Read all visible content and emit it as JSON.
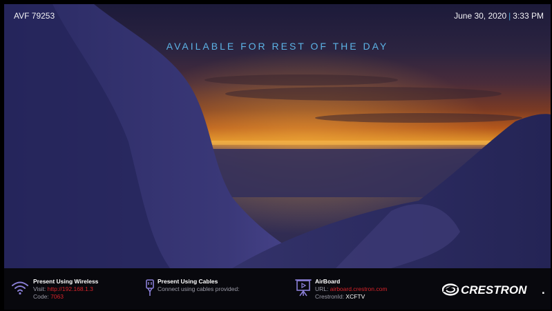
{
  "header": {
    "room_name": "AVF 79253",
    "date": "June 30, 2020",
    "separator": "|",
    "time": "3:33 PM"
  },
  "status": {
    "message": "AVAILABLE FOR REST OF THE DAY"
  },
  "footer": {
    "wireless": {
      "icon": "wifi-icon",
      "title": "Present Using Wireless",
      "visit_label": "Visit:",
      "visit_url": "http://192.168.1.3",
      "code_label": "Code:",
      "code_value": "7063"
    },
    "cables": {
      "icon": "cable-plug-icon",
      "title": "Present Using Cables",
      "description": "Connect using cables provided:"
    },
    "airboard": {
      "icon": "airboard-easel-icon",
      "title": "AirBoard",
      "url_label": "URL:",
      "url_value": "airboard.crestron.com",
      "id_label": "CrestronId:",
      "id_value": "XCFTV"
    },
    "brand": {
      "name": "CRESTRON",
      "trademark": "."
    }
  },
  "colors": {
    "accent_blue": "#5cb3e6",
    "link_red": "#d8232a",
    "footer_bg": "#08080d",
    "icon_purple": "#8a7fd6"
  }
}
